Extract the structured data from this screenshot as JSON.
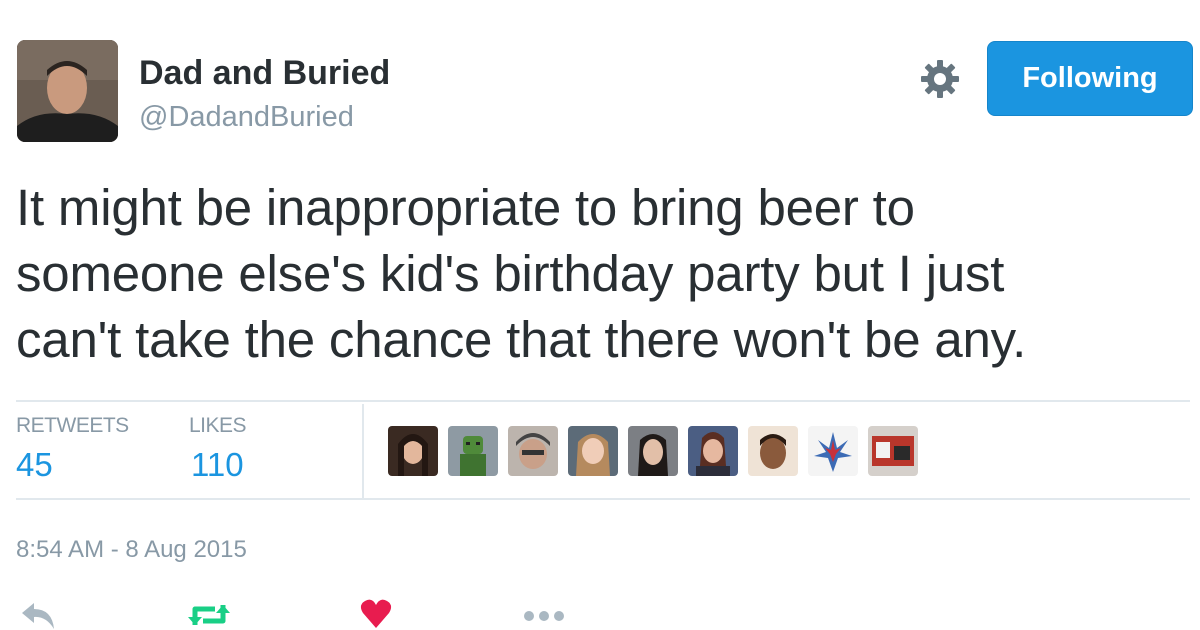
{
  "user": {
    "display_name": "Dad and Buried",
    "handle": "@DadandBuried",
    "avatar_icon": "profile-photo"
  },
  "header": {
    "settings_icon": "gear-icon",
    "follow_button_label": "Following",
    "accent_color": "#1b95e0"
  },
  "tweet": {
    "text_lines": [
      "It might be inappropriate to bring beer to",
      "someone else's kid's birthday party but I just",
      "can't take the chance that there won't be any."
    ]
  },
  "stats": {
    "retweets_label": "RETWEETS",
    "retweets_count": "45",
    "likes_label": "LIKES",
    "likes_count": "110"
  },
  "likers": [
    {
      "name": "liker-avatar-1"
    },
    {
      "name": "liker-avatar-2"
    },
    {
      "name": "liker-avatar-3"
    },
    {
      "name": "liker-avatar-4"
    },
    {
      "name": "liker-avatar-5"
    },
    {
      "name": "liker-avatar-6"
    },
    {
      "name": "liker-avatar-7"
    },
    {
      "name": "liker-avatar-8"
    },
    {
      "name": "liker-avatar-9"
    }
  ],
  "timestamp": "8:54 AM - 8 Aug 2015",
  "actions": {
    "reply_icon": "reply-icon",
    "retweet_icon": "retweet-icon",
    "like_icon": "heart-icon",
    "more_icon": "more-icon",
    "retweet_color": "#19cf86",
    "like_color": "#e81c4f"
  }
}
